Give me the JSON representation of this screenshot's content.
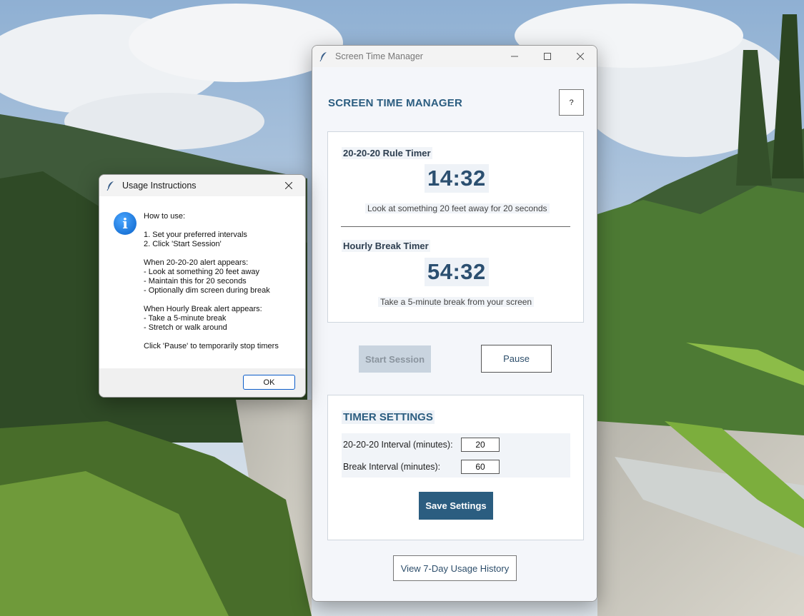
{
  "colors": {
    "accent": "#2b5d80",
    "timer_text": "#2b4f70",
    "disabled_button": "#c9d4df",
    "dialog_focus": "#0b5cc9"
  },
  "main_window": {
    "title": "Screen Time Manager",
    "app_icon": "feather-icon",
    "app_title": "SCREEN TIME MANAGER",
    "help_label": "?",
    "rule_timer": {
      "label": "20-20-20 Rule Timer",
      "time": "14:32",
      "hint": "Look at something 20 feet away for 20 seconds"
    },
    "break_timer": {
      "label": "Hourly Break Timer",
      "time": "54:32",
      "hint": "Take a 5-minute break from your screen"
    },
    "start_label": "Start Session",
    "pause_label": "Pause",
    "settings": {
      "title": "TIMER SETTINGS",
      "rule_interval_label": "20-20-20 Interval (minutes):",
      "rule_interval_value": "20",
      "break_interval_label": "Break Interval (minutes):",
      "break_interval_value": "60",
      "save_label": "Save Settings"
    },
    "history_label": "View 7-Day Usage History"
  },
  "dialog": {
    "title": "Usage Instructions",
    "app_icon": "feather-icon",
    "info_icon": "info-icon",
    "lines": [
      "How to use:",
      "",
      "1. Set your preferred intervals",
      "2. Click 'Start Session'",
      "",
      "When 20-20-20 alert appears:",
      "- Look at something 20 feet away",
      "- Maintain this for 20 seconds",
      "- Optionally dim screen during break",
      "",
      "When Hourly Break alert appears:",
      "- Take a 5-minute break",
      "- Stretch or walk around",
      "",
      "Click 'Pause' to temporarily stop timers"
    ],
    "ok_label": "OK"
  }
}
